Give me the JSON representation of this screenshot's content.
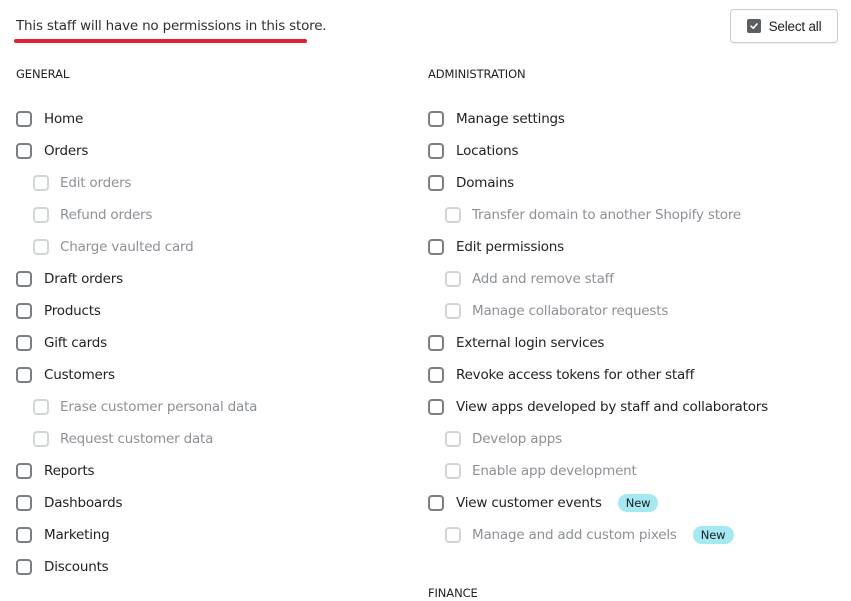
{
  "notice": "This staff will have no permissions in this store.",
  "select_all": {
    "label": "Select all",
    "checked": true
  },
  "colors": {
    "underline": "#e5202e",
    "badge_bg": "#a4e8f2"
  },
  "general": {
    "title": "GENERAL",
    "items": [
      {
        "label": "Home",
        "sub": false,
        "checked": false
      },
      {
        "label": "Orders",
        "sub": false,
        "checked": false
      },
      {
        "label": "Edit orders",
        "sub": true,
        "checked": false,
        "disabled": true
      },
      {
        "label": "Refund orders",
        "sub": true,
        "checked": false,
        "disabled": true
      },
      {
        "label": "Charge vaulted card",
        "sub": true,
        "checked": false,
        "disabled": true
      },
      {
        "label": "Draft orders",
        "sub": false,
        "checked": false
      },
      {
        "label": "Products",
        "sub": false,
        "checked": false
      },
      {
        "label": "Gift cards",
        "sub": false,
        "checked": false
      },
      {
        "label": "Customers",
        "sub": false,
        "checked": false
      },
      {
        "label": "Erase customer personal data",
        "sub": true,
        "checked": false,
        "disabled": true
      },
      {
        "label": "Request customer data",
        "sub": true,
        "checked": false,
        "disabled": true
      },
      {
        "label": "Reports",
        "sub": false,
        "checked": false
      },
      {
        "label": "Dashboards",
        "sub": false,
        "checked": false
      },
      {
        "label": "Marketing",
        "sub": false,
        "checked": false
      },
      {
        "label": "Discounts",
        "sub": false,
        "checked": false
      }
    ]
  },
  "administration": {
    "title": "ADMINISTRATION",
    "items": [
      {
        "label": "Manage settings",
        "sub": false,
        "checked": false
      },
      {
        "label": "Locations",
        "sub": false,
        "checked": false
      },
      {
        "label": "Domains",
        "sub": false,
        "checked": false
      },
      {
        "label": "Transfer domain to another Shopify store",
        "sub": true,
        "checked": false,
        "disabled": true
      },
      {
        "label": "Edit permissions",
        "sub": false,
        "checked": false
      },
      {
        "label": "Add and remove staff",
        "sub": true,
        "checked": false,
        "disabled": true
      },
      {
        "label": "Manage collaborator requests",
        "sub": true,
        "checked": false,
        "disabled": true
      },
      {
        "label": "External login services",
        "sub": false,
        "checked": false
      },
      {
        "label": "Revoke access tokens for other staff",
        "sub": false,
        "checked": false
      },
      {
        "label": "View apps developed by staff and collaborators",
        "sub": false,
        "checked": false
      },
      {
        "label": "Develop apps",
        "sub": true,
        "checked": false,
        "disabled": true
      },
      {
        "label": "Enable app development",
        "sub": true,
        "checked": false,
        "disabled": true
      },
      {
        "label": "View customer events",
        "sub": false,
        "checked": false,
        "badge": "New"
      },
      {
        "label": "Manage and add custom pixels",
        "sub": true,
        "checked": false,
        "disabled": true,
        "badge": "New"
      }
    ]
  },
  "finance": {
    "title": "FINANCE"
  }
}
